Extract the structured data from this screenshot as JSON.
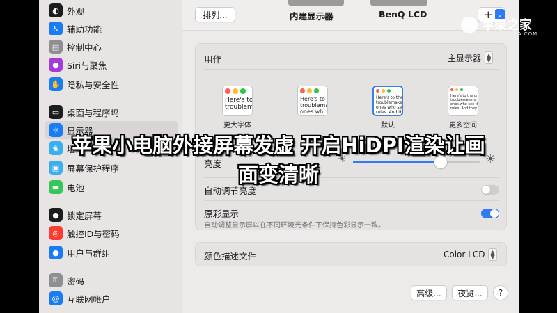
{
  "sidebar": {
    "items": [
      {
        "label": "外观",
        "icon": "appearance-icon",
        "color": "#1d1d1f"
      },
      {
        "label": "辅助功能",
        "icon": "accessibility-icon",
        "color": "#1a7cf4"
      },
      {
        "label": "控制中心",
        "icon": "control-center-icon",
        "color": "#8e8e93"
      },
      {
        "label": "Siri与聚焦",
        "icon": "siri-icon",
        "color": "#a63bd9"
      },
      {
        "label": "隐私与安全性",
        "icon": "hand-icon",
        "color": "#1a7cf4"
      },
      {
        "label": "桌面与程序坞",
        "icon": "dock-icon",
        "color": "#1d1d1f"
      },
      {
        "label": "显示器",
        "icon": "display-icon",
        "color": "#1a7cf4"
      },
      {
        "label": "墙纸",
        "icon": "wallpaper-icon",
        "color": "#3ab0f0"
      },
      {
        "label": "屏幕保护程序",
        "icon": "screensaver-icon",
        "color": "#3ab0f0"
      },
      {
        "label": "电池",
        "icon": "battery-icon",
        "color": "#34c759"
      },
      {
        "label": "锁定屏幕",
        "icon": "lock-icon",
        "color": "#1d1d1f"
      },
      {
        "label": "触控ID与密码",
        "icon": "fingerprint-icon",
        "color": "#ff3b30"
      },
      {
        "label": "用户与群组",
        "icon": "users-icon",
        "color": "#1a7cf4"
      },
      {
        "label": "密码",
        "icon": "key-icon",
        "color": "#8e8e93"
      },
      {
        "label": "互联网帐户",
        "icon": "at-icon",
        "color": "#1a7cf4"
      }
    ]
  },
  "toolbar": {
    "arrange_label": "排列...",
    "tab_builtin": "内建显示器",
    "tab_external": "BenQ LCD",
    "add_label": "+",
    "dropdown_glyph": "⌄"
  },
  "usage": {
    "label": "用作",
    "value": "主显示器"
  },
  "resolution": {
    "options": [
      {
        "label": "更大字体",
        "text": "Here's to\ntroublem"
      },
      {
        "label": "",
        "text": "Here's to\ntroublema\nones wh"
      },
      {
        "label": "默认",
        "text": "Here's to the\ntroublemakers.\nones who see t\nrules. And they"
      },
      {
        "label": "更多空间",
        "text": "Here's to the cr\ntroublemakers. T\nones who see th\nrules. And they"
      }
    ],
    "selected_index": 2
  },
  "brightness": {
    "label": "亮度",
    "level": 0.69,
    "auto_label": "自动调节亮度",
    "auto_on": false
  },
  "true_tone": {
    "label": "原彩显示",
    "desc": "自动调整显示屏以在不同环境光条件下保持色彩显示一致。",
    "on": true
  },
  "color_profile": {
    "label": "颜色描述文件",
    "value": "Color LCD"
  },
  "footer": {
    "advanced_label": "高级...",
    "night_shift_label": "夜览...",
    "help_label": "?"
  },
  "caption": {
    "line1": "苹果小电脑外接屏幕发虚 开启HiDPI渲染让画",
    "line2": "面变清晰"
  },
  "watermark": {
    "title": "苹果之家",
    "sub": "APPLEZHIJIA.COM"
  },
  "colors": {
    "accent": "#2f7bf5",
    "toggle_off": "#d0cecd"
  }
}
